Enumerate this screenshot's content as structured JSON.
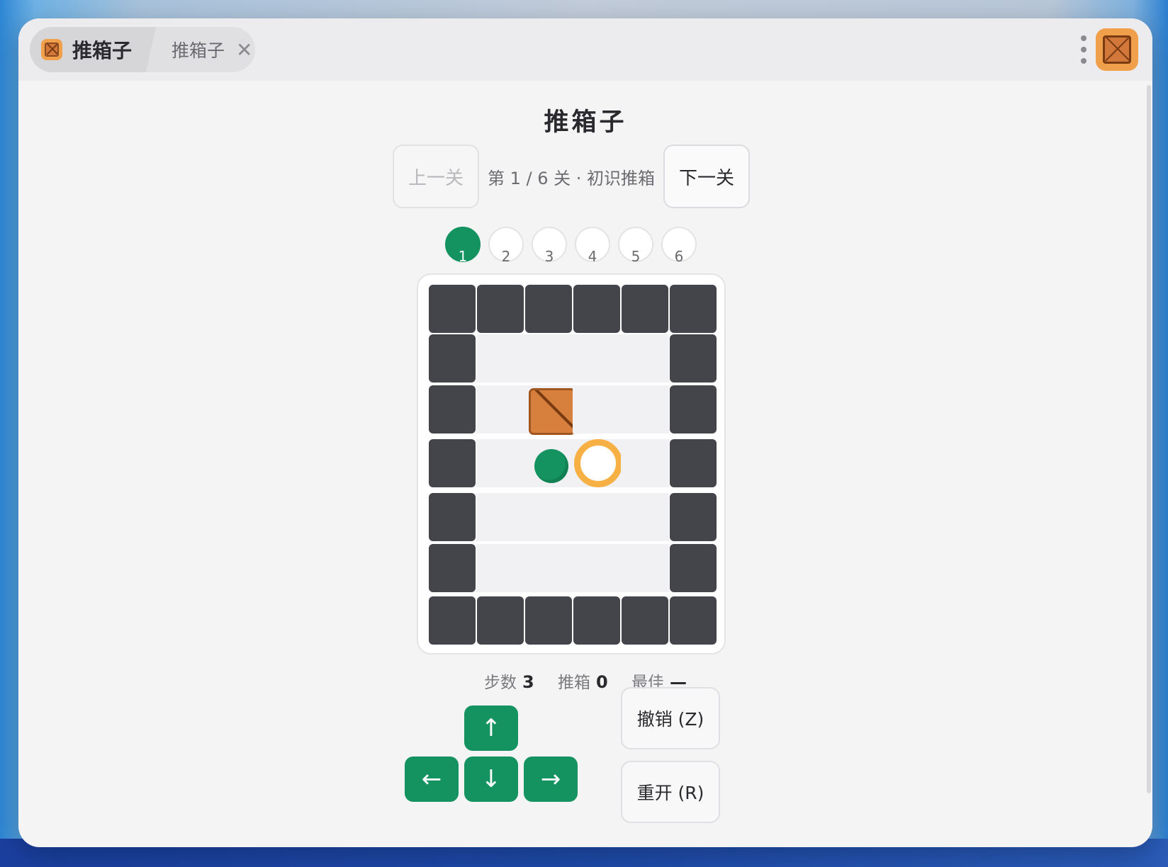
{
  "window": {
    "tab_active_title": "推箱子",
    "tab_second_title": "推箱子",
    "tab_close_symbol": "✕",
    "app_icon": "crate-icon"
  },
  "game": {
    "title": "推箱子",
    "prev_label": "上一关",
    "next_label": "下一关",
    "level_info": "第 1 / 6 关 · 初识推箱",
    "levels": [
      "1",
      "2",
      "3",
      "4",
      "5",
      "6"
    ],
    "current_level": 1
  },
  "board": {
    "rows": 7,
    "cols": 6,
    "grid": [
      "######",
      "#    #",
      "# $  #",
      "# @. #",
      "#    #",
      "#    #",
      "######"
    ],
    "legend": {
      "#": "wall",
      " ": "floor",
      "$": "box",
      "@": "player",
      ".": "goal"
    }
  },
  "stats": {
    "steps_label": "步数",
    "steps_value": "3",
    "pushes_label": "推箱",
    "pushes_value": "0",
    "best_label": "最佳",
    "best_value": "—"
  },
  "controls": {
    "up": "↑",
    "down": "↓",
    "left": "←",
    "right": "→",
    "undo_label": "撤销 (Z)",
    "restart_label": "重开 (R)"
  },
  "colors": {
    "accent": "#14925f",
    "wall": "#44444b",
    "box": "#d7803e",
    "goal": "#f6b043"
  }
}
